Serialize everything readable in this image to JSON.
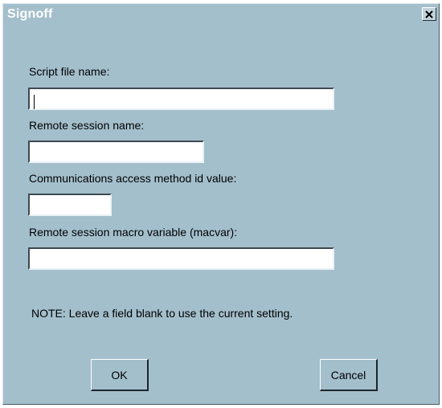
{
  "window": {
    "title": "Signoff",
    "close_icon": "close-icon"
  },
  "fields": [
    {
      "label": "Script file name:",
      "value": "",
      "placeholder": ""
    },
    {
      "label": "Remote session name:",
      "value": "",
      "placeholder": ""
    },
    {
      "label": "Communications access method id value:",
      "value": "",
      "placeholder": ""
    },
    {
      "label": "Remote session macro variable (macvar):",
      "value": "",
      "placeholder": ""
    }
  ],
  "note": "NOTE: Leave a field blank to use the current setting.",
  "buttons": {
    "ok": "OK",
    "cancel": "Cancel"
  },
  "colors": {
    "dialog_background": "#a3bfcc",
    "title_text": "#ffffff"
  }
}
